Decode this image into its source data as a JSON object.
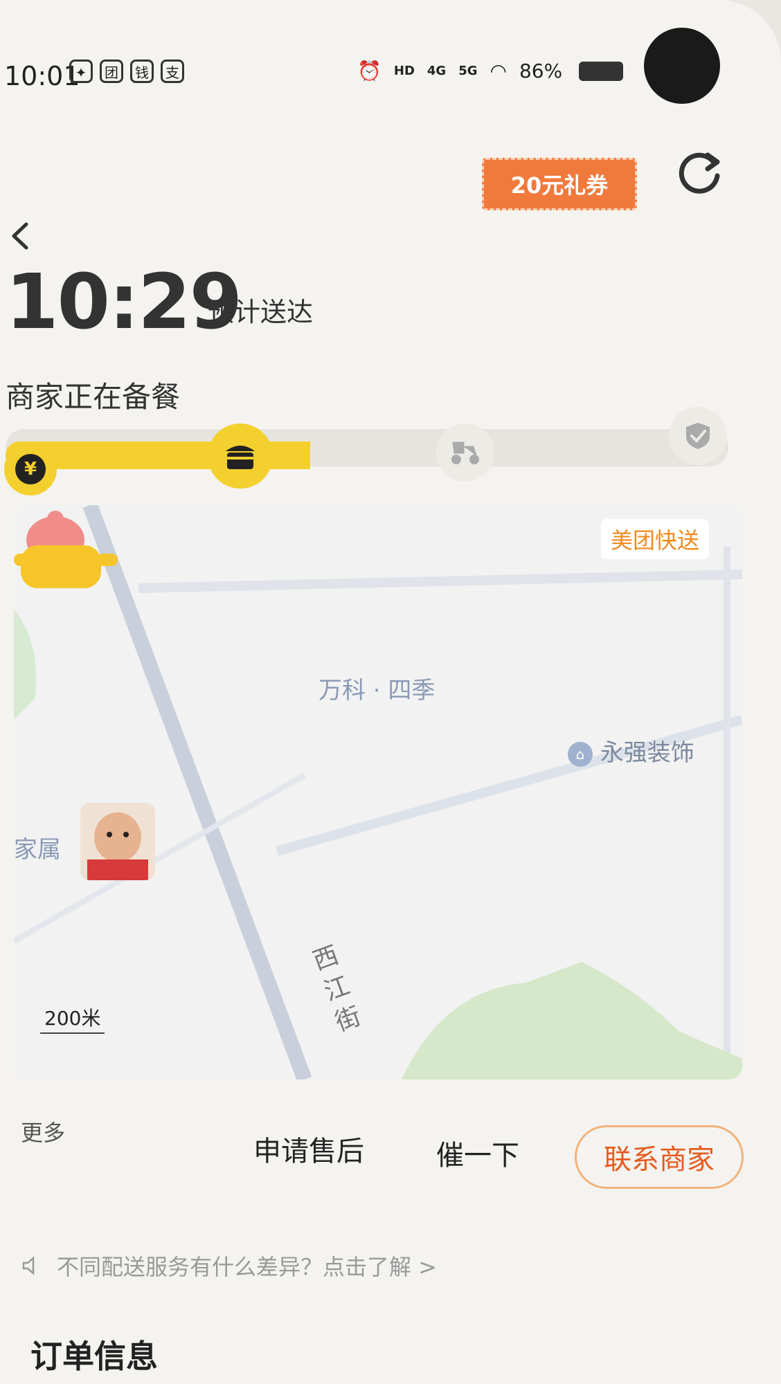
{
  "status_bar": {
    "time": "10:01",
    "app_icons": [
      "flame-icon",
      "meituan-icon",
      "wallet-icon",
      "pay-icon"
    ],
    "network": [
      "HD",
      "4G",
      "5G"
    ],
    "battery": "86%"
  },
  "header": {
    "coupon_label": "20元礼券",
    "eta_time": "10:29",
    "eta_label": "预计送达",
    "status_text": "商家正在备餐"
  },
  "progress": {
    "steps": [
      "paid-icon",
      "shop-icon",
      "rider-icon",
      "check-icon"
    ],
    "current_step": 2,
    "colors": {
      "active": "#f3d02e",
      "inactive": "#e6e4de"
    }
  },
  "map": {
    "badge": "美团快送",
    "labels": {
      "area": "万科 · 四季",
      "poi": "永强装饰",
      "residence": "家属",
      "street": "西江街",
      "top_partial": "—"
    },
    "scale": "200米"
  },
  "actions": {
    "more": "更多",
    "after_sales": "申请售后",
    "urge": "催一下",
    "contact_merchant": "联系商家"
  },
  "info_tip": "不同配送服务有什么差异？点击了解 >",
  "order_info_title": "订单信息",
  "colors": {
    "accent_yellow": "#f3d02e",
    "coupon_orange": "#f07a3c",
    "contact_orange": "#e65b1e"
  }
}
